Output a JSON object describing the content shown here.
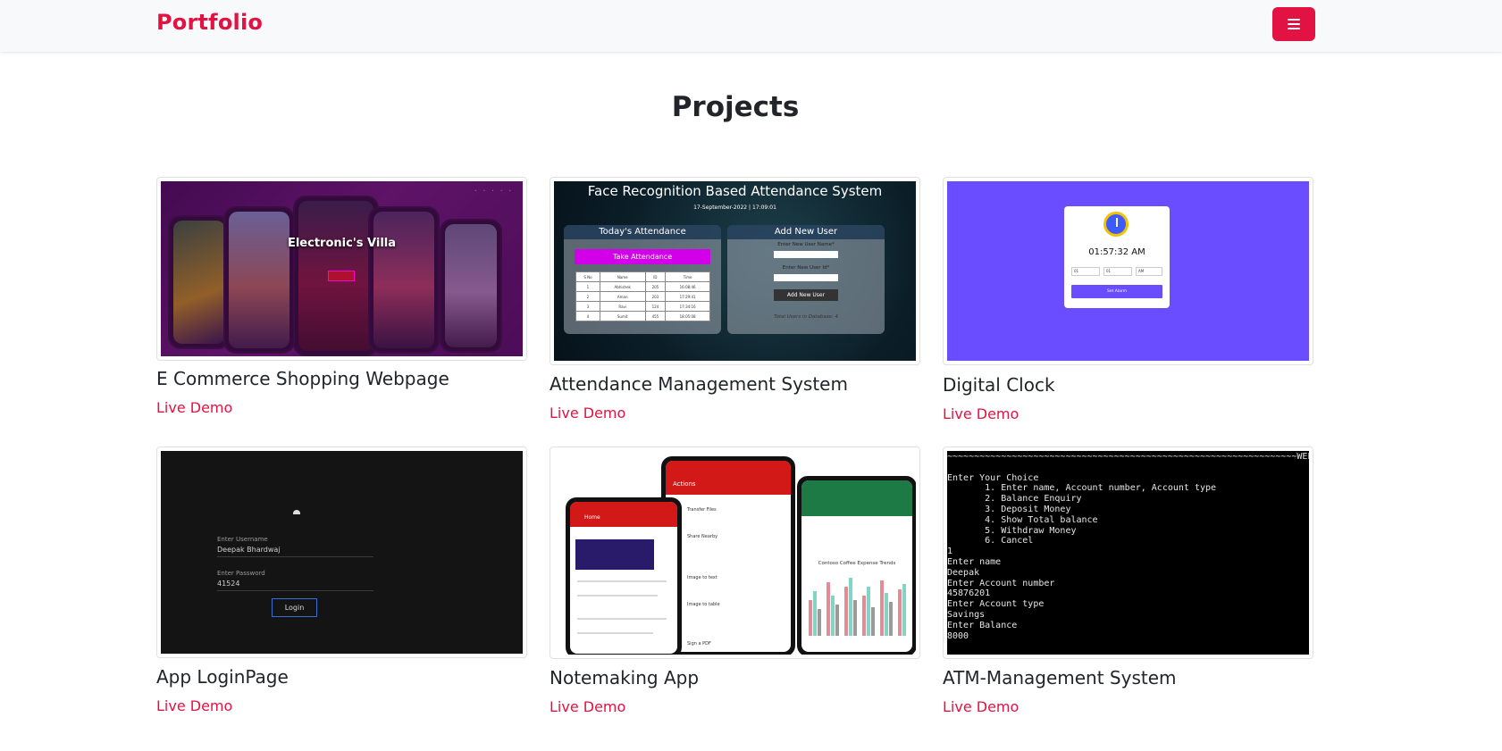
{
  "navbar": {
    "brand": "Portfolio",
    "menu_icon": "hamburger-icon"
  },
  "section": {
    "title": "Projects"
  },
  "projects": [
    {
      "title": "E Commerce Shopping Webpage",
      "link": "Live Demo",
      "thumb_text": "Electronic's Villa"
    },
    {
      "title": "Attendance Management System",
      "link": "Live Demo",
      "thumb": {
        "heading": "Face Recognition Based Attendance System",
        "date": "17-September-2022 | 17:09:01",
        "left_panel": "Today's Attendance",
        "take_button": "Take Attendance",
        "table_head": [
          "S No",
          "Name",
          "ID",
          "Time"
        ],
        "table_rows": [
          [
            "1",
            "Abhishek",
            "205",
            "16:08:46"
          ],
          [
            "2",
            "Aman",
            "203",
            "17:29:41"
          ],
          [
            "3",
            "Ravi",
            "124",
            "17:34:16"
          ],
          [
            "4",
            "Sumit",
            "455",
            "18:05:08"
          ]
        ],
        "right_panel": "Add New User",
        "name_label": "Enter New User Name*",
        "id_label": "Enter New User Id*",
        "add_button": "Add New User",
        "total": "Total Users in Database: 4"
      }
    },
    {
      "title": "Digital Clock",
      "link": "Live Demo",
      "thumb": {
        "time": "01:57:32 AM",
        "hour": "01",
        "minute": "01",
        "ampm": "AM",
        "button": "Set Alarm"
      }
    },
    {
      "title": "App LoginPage",
      "link": "Live Demo",
      "thumb": {
        "user_label": "Enter Username",
        "user_value": "Deepak Bhardwaj",
        "pass_label": "Enter Password",
        "pass_value": "41524",
        "button": "Login"
      }
    },
    {
      "title": "Notemaking App",
      "link": "Live Demo",
      "thumb": {
        "phone_header": "Home",
        "mid_header": "Actions",
        "sheet_header": "Contoso Coffee Expense Trends",
        "items": [
          "Transfer Files",
          "Share Nearby",
          "Image to text",
          "Image to table",
          "Sign a PDF"
        ]
      }
    },
    {
      "title": "ATM-Management System",
      "link": "Live Demo",
      "thumb": {
        "console": "~~~~~~~~~~~~~~~~~~~~~~~~~~~~~~~~~~~~~~~~~~~~~~~~~~~~~~~~~~~~~~~~~WELCOME~\n\nEnter Your Choice\n       1. Enter name, Account number, Account type\n       2. Balance Enquiry\n       3. Deposit Money\n       4. Show Total balance\n       5. Withdraw Money\n       6. Cancel\n1\nEnter name\nDeepak\nEnter Account number\n45876201\nEnter Account type\nSavings\nEnter Balance\n8000"
      }
    }
  ]
}
